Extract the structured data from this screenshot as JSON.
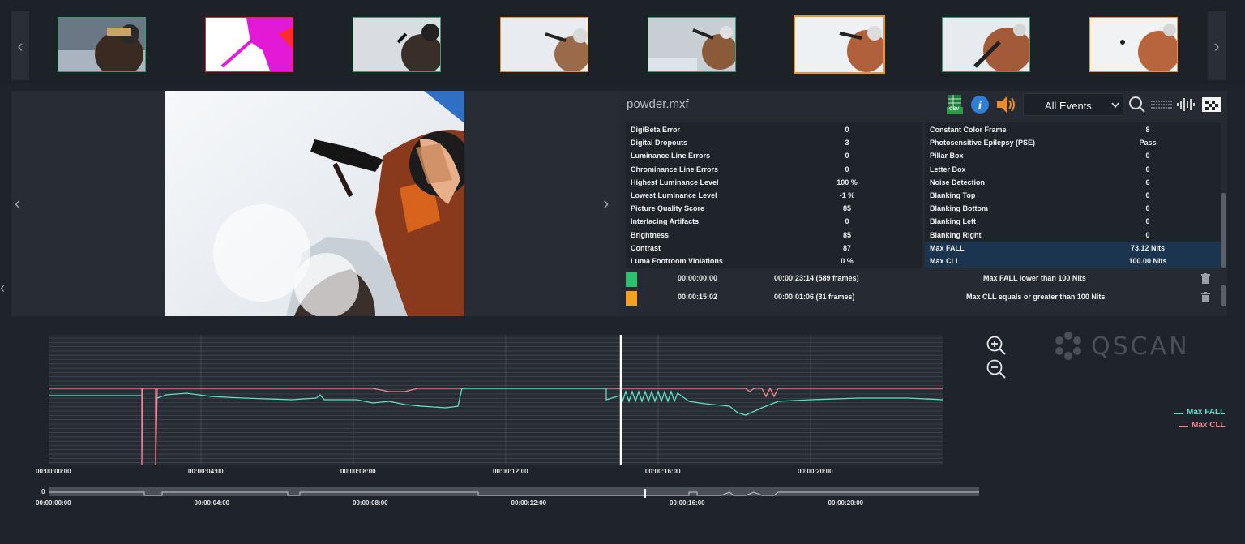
{
  "filmstrip": {
    "prev_icon": "chevron-left-icon",
    "next_icon": "chevron-right-icon",
    "prev_glyph": "‹",
    "next_glyph": "›",
    "thumbnails": [
      {
        "state": "normal"
      },
      {
        "state": "error"
      },
      {
        "state": "normal"
      },
      {
        "state": "warning"
      },
      {
        "state": "normal"
      },
      {
        "state": "selected"
      },
      {
        "state": "normal"
      },
      {
        "state": "warning"
      }
    ]
  },
  "player": {
    "prev_glyph": "‹",
    "next_glyph": "›",
    "far_left_glyph": "‹"
  },
  "panel": {
    "file_name": "powder.mxf",
    "csv_label": "CSV",
    "filter": {
      "selected": "All Events"
    },
    "left_metrics": [
      {
        "label": "DigiBeta Error",
        "value": "0"
      },
      {
        "label": "Digital Dropouts",
        "value": "3"
      },
      {
        "label": "Luminance Line Errors",
        "value": "0"
      },
      {
        "label": "Chrominance Line Errors",
        "value": "0"
      },
      {
        "label": "Highest Luminance Level",
        "value": "100 %"
      },
      {
        "label": "Lowest Luminance Level",
        "value": "-1 %"
      },
      {
        "label": "Picture Quality Score",
        "value": "85"
      },
      {
        "label": "Interlacing Artifacts",
        "value": "0"
      },
      {
        "label": "Brightness",
        "value": "85"
      },
      {
        "label": "Contrast",
        "value": "87"
      },
      {
        "label": "Luma Footroom Violations",
        "value": "0 %"
      }
    ],
    "right_metrics": [
      {
        "label": "Constant Color Frame",
        "value": "8"
      },
      {
        "label": "Photosensitive Epilepsy (PSE)",
        "value": "Pass"
      },
      {
        "label": "Pillar Box",
        "value": "0"
      },
      {
        "label": "Letter Box",
        "value": "0"
      },
      {
        "label": "Noise Detection",
        "value": "6"
      },
      {
        "label": "Blanking Top",
        "value": "0"
      },
      {
        "label": "Blanking Bottom",
        "value": "0"
      },
      {
        "label": "Blanking Left",
        "value": "0"
      },
      {
        "label": "Blanking Right",
        "value": "0"
      },
      {
        "label": "Max FALL",
        "value": "73.12 Nits"
      },
      {
        "label": "Max CLL",
        "value": "100.00 Nits"
      }
    ],
    "events": [
      {
        "color": "#2fbf71",
        "start": "00:00:00:00",
        "duration": "00:00:23:14 (589 frames)",
        "description": "Max FALL lower than 100 Nits"
      },
      {
        "color": "#f7a01c",
        "start": "00:00:15:02",
        "duration": "00:00:01:06 (31 frames)",
        "description": "Max CLL equals or greater than 100 Nits"
      }
    ]
  },
  "graph": {
    "time_ticks": [
      "00:00:00:00",
      "00:00:04:00",
      "00:00:08:00",
      "00:00:12:00",
      "00:00:16:00",
      "00:00:20:00"
    ],
    "mini_ticks": [
      "00:00:00:00",
      "00:00:04:00",
      "00:00:08:00",
      "00:00:12:00",
      "00:00:16:00",
      "00:00:20:00"
    ],
    "mini_zero": "0",
    "legend": [
      {
        "name": "Max FALL",
        "color": "#5fe0c8"
      },
      {
        "name": "Max CLL",
        "color": "#f08a96"
      }
    ],
    "zoom_in_icon": "zoom-in-icon",
    "zoom_out_icon": "zoom-out-icon"
  },
  "brand": {
    "logo_text": "QSCAN"
  }
}
